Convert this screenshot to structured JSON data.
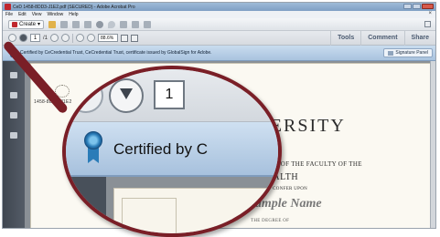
{
  "window": {
    "title": "CeD 1458-8DD3-J1E2.pdf (SECURED) - Adobe Acrobat Pro"
  },
  "menu": {
    "items": [
      "File",
      "Edit",
      "View",
      "Window",
      "Help"
    ],
    "close_glyph": "×"
  },
  "toolbar": {
    "create_label": "Create",
    "page_current": "1",
    "page_total": "/1",
    "zoom": "88.6%",
    "tabs": [
      "Tools",
      "Comment",
      "Share"
    ]
  },
  "certificate_bar": {
    "message": "Certified by CeCredential Trust, CeCredential Trust, certificate issued by GlobalSign for Adobe.",
    "signature_panel_label": "Signature Panel"
  },
  "document": {
    "doc_id": "1458-8DD3-J1E2",
    "university": "University",
    "recommendation": "RECOMMENDATION OF THE FACULTY OF THE",
    "school": "OOL OF PUBLIC HEALTH",
    "hereby": "HEREBY CONFER UPON",
    "name": "John Sample Name",
    "degree_line": "THE DEGREE OF"
  },
  "magnifier": {
    "page_number": "1",
    "cert_text": "Certified by C"
  },
  "colors": {
    "accent": "#7a1f27",
    "cert_bar": "#a9c3de",
    "ribbon": "#2a7cb8"
  },
  "icons": [
    "adobe-acrobat-icon",
    "folder-icon",
    "save-icon",
    "print-icon",
    "email-icon",
    "gear-icon",
    "comment-icon",
    "ribbon-icon",
    "pen-icon",
    "previous-page-icon",
    "next-page-icon",
    "zoom-out-icon",
    "zoom-in-icon"
  ]
}
